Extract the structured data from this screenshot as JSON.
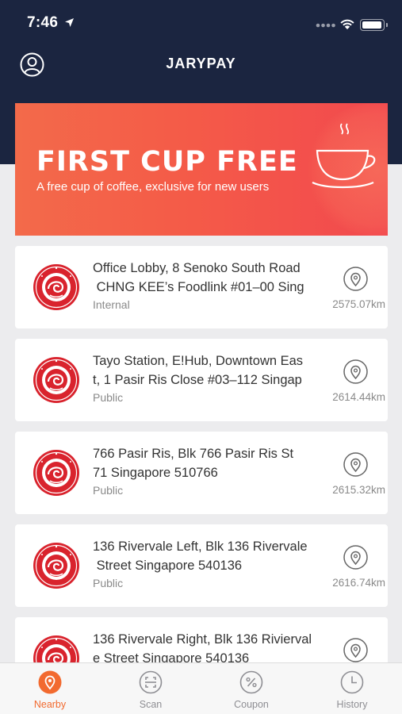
{
  "status": {
    "time": "7:46"
  },
  "header": {
    "title": "JARYPAY"
  },
  "banner": {
    "headline": "FIRST CUP FREE",
    "subtitle": "A free cup of coffee, exclusive for new users"
  },
  "locations": [
    {
      "line1": "Office Lobby, 8 Senoko South Road",
      "line2": " CHNG KEE’s Foodlink #01–00 Sing",
      "type": "Internal",
      "distance": "2575.07km"
    },
    {
      "line1": "Tayo Station, E!Hub, Downtown Eas",
      "line2": "t, 1 Pasir Ris Close #03–112 Singap",
      "type": "Public",
      "distance": "2614.44km"
    },
    {
      "line1": "766 Pasir Ris, Blk 766 Pasir Ris St",
      "line2": "71 Singapore 510766",
      "type": "Public",
      "distance": "2615.32km"
    },
    {
      "line1": "136 Rivervale Left, Blk 136 Rivervale",
      "line2": " Street Singapore 540136",
      "type": "Public",
      "distance": "2616.74km"
    },
    {
      "line1": "136 Rivervale Right, Blk 136 Rivierval",
      "line2": "e Street Singapore 540136",
      "type": "",
      "distance": ""
    }
  ],
  "tabs": [
    {
      "label": "Nearby",
      "icon": "location-pin-icon",
      "active": true
    },
    {
      "label": "Scan",
      "icon": "scan-icon",
      "active": false
    },
    {
      "label": "Coupon",
      "icon": "coupon-icon",
      "active": false
    },
    {
      "label": "History",
      "icon": "clock-icon",
      "active": false
    }
  ],
  "colors": {
    "header": "#1b2540",
    "accent": "#f26a2f",
    "banner": "#f45b48",
    "logo_red": "#d9232d"
  }
}
